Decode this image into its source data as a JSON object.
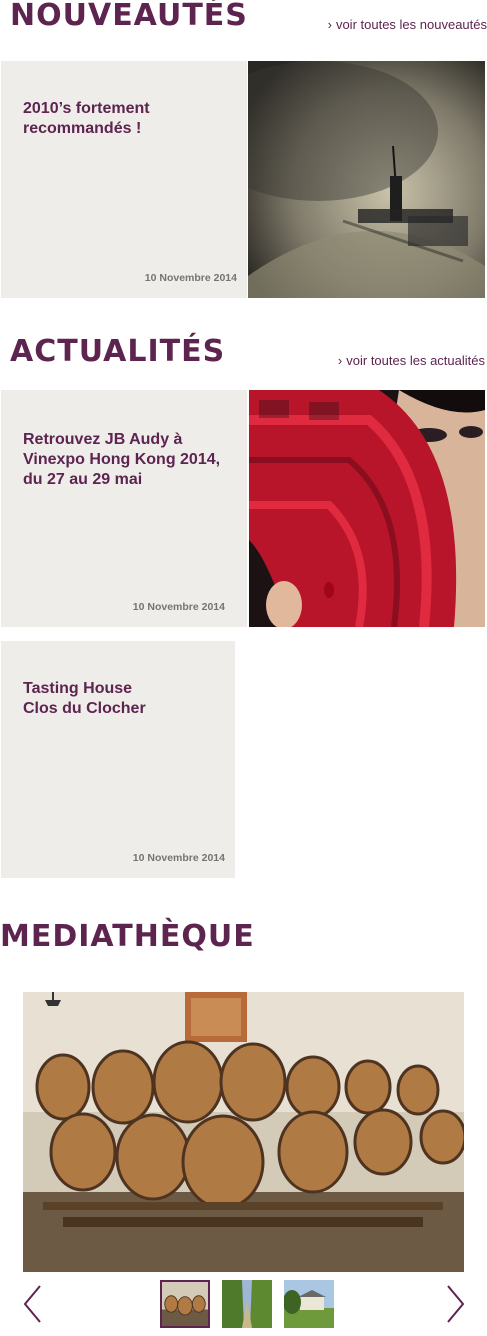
{
  "nouveautes": {
    "title": "NOUVEAUTÉS",
    "see_all": "voir toutes les nouveautés",
    "card": {
      "title": "2010’s fortement\nrecommandés !",
      "date": "10 Novembre 2014"
    }
  },
  "actualites": {
    "title": "ACTUALITÉS",
    "see_all": "voir toutes les actualités",
    "cards": [
      {
        "title": "Retrouvez JB Audy à\nVinexpo Hong Kong 2014,\ndu 27 au 29 mai",
        "date": "10 Novembre 2014"
      },
      {
        "title": "Tasting House\nClos du Clocher",
        "date": "10 Novembre 2014"
      }
    ]
  },
  "mediatheque": {
    "title": "MEDIATHÈQUE"
  },
  "icons": {
    "see_all_arrow": "chevron-right-icon",
    "prev": "chevron-left-icon",
    "next": "chevron-right-icon"
  },
  "colors": {
    "accent": "#5d2450",
    "card_bg": "#efede9",
    "date_text": "#777371"
  }
}
